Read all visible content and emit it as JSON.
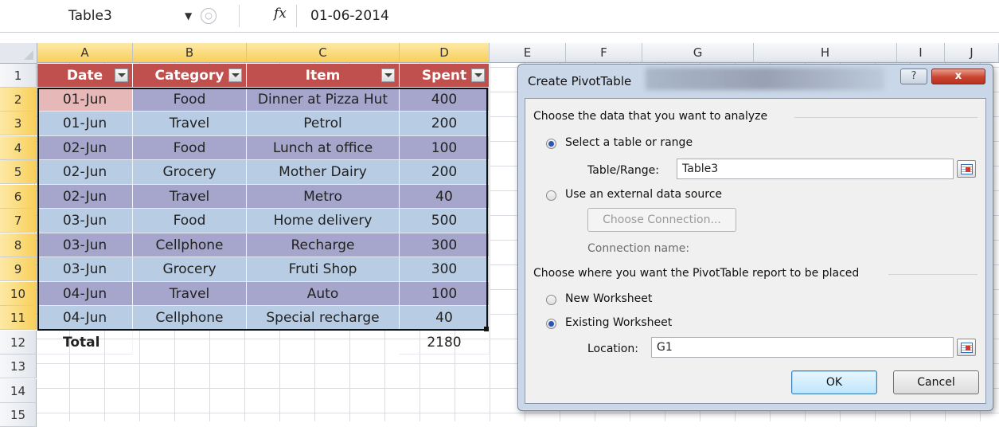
{
  "formula_bar": {
    "name_box": "Table3",
    "fx_label": "fx",
    "value": "01-06-2014"
  },
  "columns": [
    "A",
    "B",
    "C",
    "D",
    "E",
    "F",
    "G",
    "H",
    "I",
    "J"
  ],
  "rows": [
    "1",
    "2",
    "3",
    "4",
    "5",
    "6",
    "7",
    "8",
    "9",
    "10",
    "11",
    "12",
    "13",
    "14",
    "15"
  ],
  "table": {
    "headers": [
      "Date",
      "Category",
      "Item",
      "Spent"
    ],
    "rows": [
      [
        "01-Jun",
        "Food",
        "Dinner at Pizza Hut",
        "400"
      ],
      [
        "01-Jun",
        "Travel",
        "Petrol",
        "200"
      ],
      [
        "02-Jun",
        "Food",
        "Lunch at office",
        "100"
      ],
      [
        "02-Jun",
        "Grocery",
        "Mother Dairy",
        "200"
      ],
      [
        "02-Jun",
        "Travel",
        "Metro",
        "40"
      ],
      [
        "03-Jun",
        "Food",
        "Home delivery",
        "500"
      ],
      [
        "03-Jun",
        "Cellphone",
        "Recharge",
        "300"
      ],
      [
        "03-Jun",
        "Grocery",
        "Fruti Shop",
        "300"
      ],
      [
        "04-Jun",
        "Travel",
        "Auto",
        "100"
      ],
      [
        "04-Jun",
        "Cellphone",
        "Special recharge",
        "40"
      ]
    ],
    "total_label": "Total",
    "total_value": "2180"
  },
  "dialog": {
    "title": "Create PivotTable",
    "help_label": "?",
    "close_label": "x",
    "section1": "Choose the data that you want to analyze",
    "radio_select_table": "Select a table or range",
    "table_range_label": "Table/Range:",
    "table_range_value": "Table3",
    "radio_external": "Use an external data source",
    "choose_connection": "Choose Connection...",
    "connection_name": "Connection name:",
    "section2": "Choose where you want the PivotTable report to be placed",
    "radio_new_ws": "New Worksheet",
    "radio_existing_ws": "Existing Worksheet",
    "location_label": "Location:",
    "location_value": "G1",
    "ok": "OK",
    "cancel": "Cancel"
  },
  "colors": {
    "header_fill": "#c0504d",
    "band_blue": "#b8cce4",
    "band_purple": "#a6a6cc",
    "active_cell": "#e6b9b8",
    "selection_header": "#f8cf5b"
  }
}
